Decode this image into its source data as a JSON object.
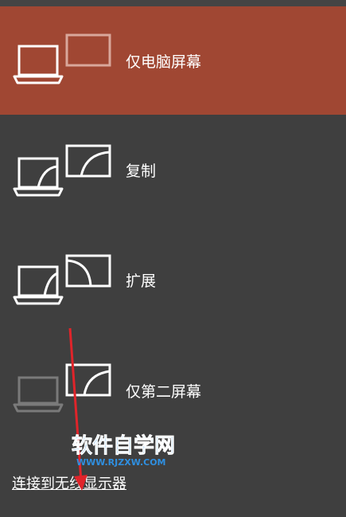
{
  "options": [
    {
      "label": "仅电脑屏幕",
      "icon": "pc-screen-only-icon",
      "selected": true
    },
    {
      "label": "复制",
      "icon": "duplicate-icon",
      "selected": false
    },
    {
      "label": "扩展",
      "icon": "extend-icon",
      "selected": false
    },
    {
      "label": "仅第二屏幕",
      "icon": "second-screen-only-icon",
      "selected": false
    }
  ],
  "footer": {
    "link_label": "连接到无线显示器"
  },
  "watermark": {
    "title": "软件自学网",
    "url": "WWW.RJZXW.COM"
  },
  "colors": {
    "panel_bg": "#3f3f3f",
    "selected_bg": "#a04733",
    "annotation_arrow": "#e0242a",
    "watermark_blue": "#2f8fe0"
  }
}
